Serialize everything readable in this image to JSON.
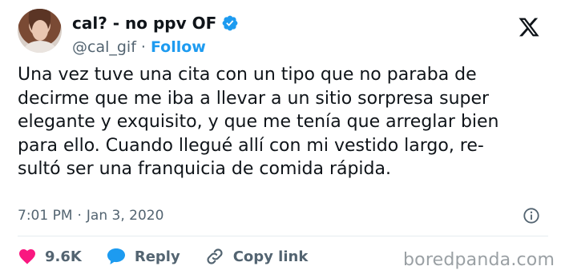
{
  "author": {
    "display_name": "cal? - no ppv OF",
    "handle": "@cal_gif",
    "separator": "·",
    "follow_label": "Follow",
    "verified_color": "#1d9bf0"
  },
  "tweet": {
    "text": "Una vez tuve una cita con un tipo que no paraba de\ndecirme que me iba a llevar a un sitio sorpresa super\nelegante y exquisito, y que me tenía que arreglar bien\npara ello. Cuando llegué allí con mi vestido largo, re-\nsultó ser una franquicia de comida rápida.",
    "time": "7:01 PM",
    "separator": "·",
    "date": "Jan 3, 2020"
  },
  "actions": {
    "likes_count": "9.6K",
    "reply_label": "Reply",
    "copy_link_label": "Copy link"
  },
  "icons": {
    "like": "heart-icon",
    "reply": "speech-bubble-icon",
    "copy": "link-icon",
    "info": "info-icon",
    "brand": "x-logo-icon"
  },
  "colors": {
    "like": "#f91880",
    "reply": "#1d9bf0",
    "link": "#1d9bf0"
  },
  "watermark": "boredpanda.com"
}
